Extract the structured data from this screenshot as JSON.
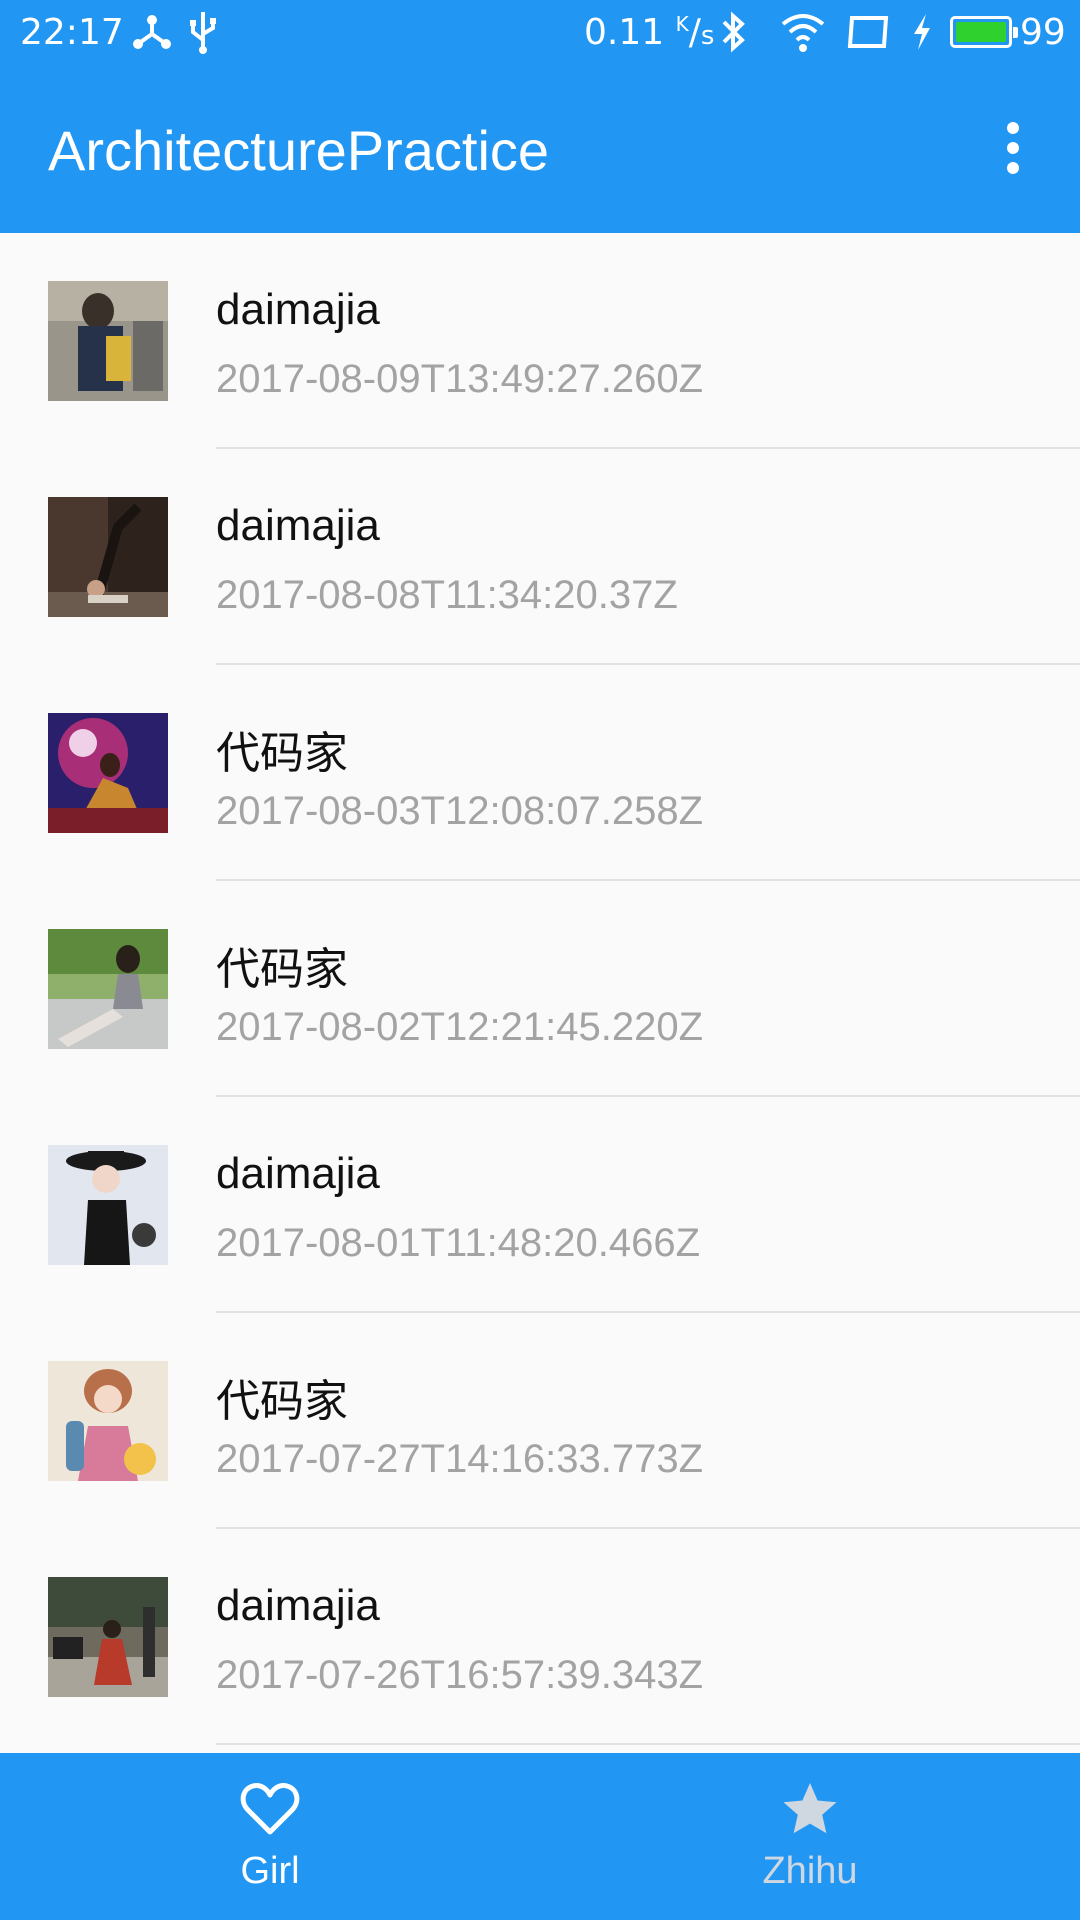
{
  "status_bar": {
    "time": "22:17",
    "speed_value": "0.11",
    "speed_unit_top": "K",
    "speed_unit_bottom": "s",
    "battery_level": "99",
    "icons": [
      "usb-tether-icon",
      "usb-icon",
      "bluetooth-icon",
      "wifi-icon",
      "screen-icon",
      "charging-icon",
      "battery-icon"
    ]
  },
  "toolbar": {
    "title": "ArchitecturePractice",
    "overflow_icon": "more-vert-icon"
  },
  "list": {
    "items": [
      {
        "title": "daimajia",
        "date": "2017-08-09T13:49:27.260Z"
      },
      {
        "title": "daimajia",
        "date": "2017-08-08T11:34:20.37Z"
      },
      {
        "title": "代码家",
        "date": "2017-08-03T12:08:07.258Z"
      },
      {
        "title": "代码家",
        "date": "2017-08-02T12:21:45.220Z"
      },
      {
        "title": "daimajia",
        "date": "2017-08-01T11:48:20.466Z"
      },
      {
        "title": "代码家",
        "date": "2017-07-27T14:16:33.773Z"
      },
      {
        "title": "daimajia",
        "date": "2017-07-26T16:57:39.343Z"
      }
    ]
  },
  "bottom_nav": {
    "items": [
      {
        "label": "Girl",
        "icon": "heart-icon",
        "selected": true
      },
      {
        "label": "Zhihu",
        "icon": "star-icon",
        "selected": false
      }
    ]
  },
  "colors": {
    "primary": "#2196f3",
    "background": "#fafafa",
    "title_text": "#111111",
    "date_text": "#a3a3a3",
    "nav_inactive": "#cfd8e0"
  }
}
